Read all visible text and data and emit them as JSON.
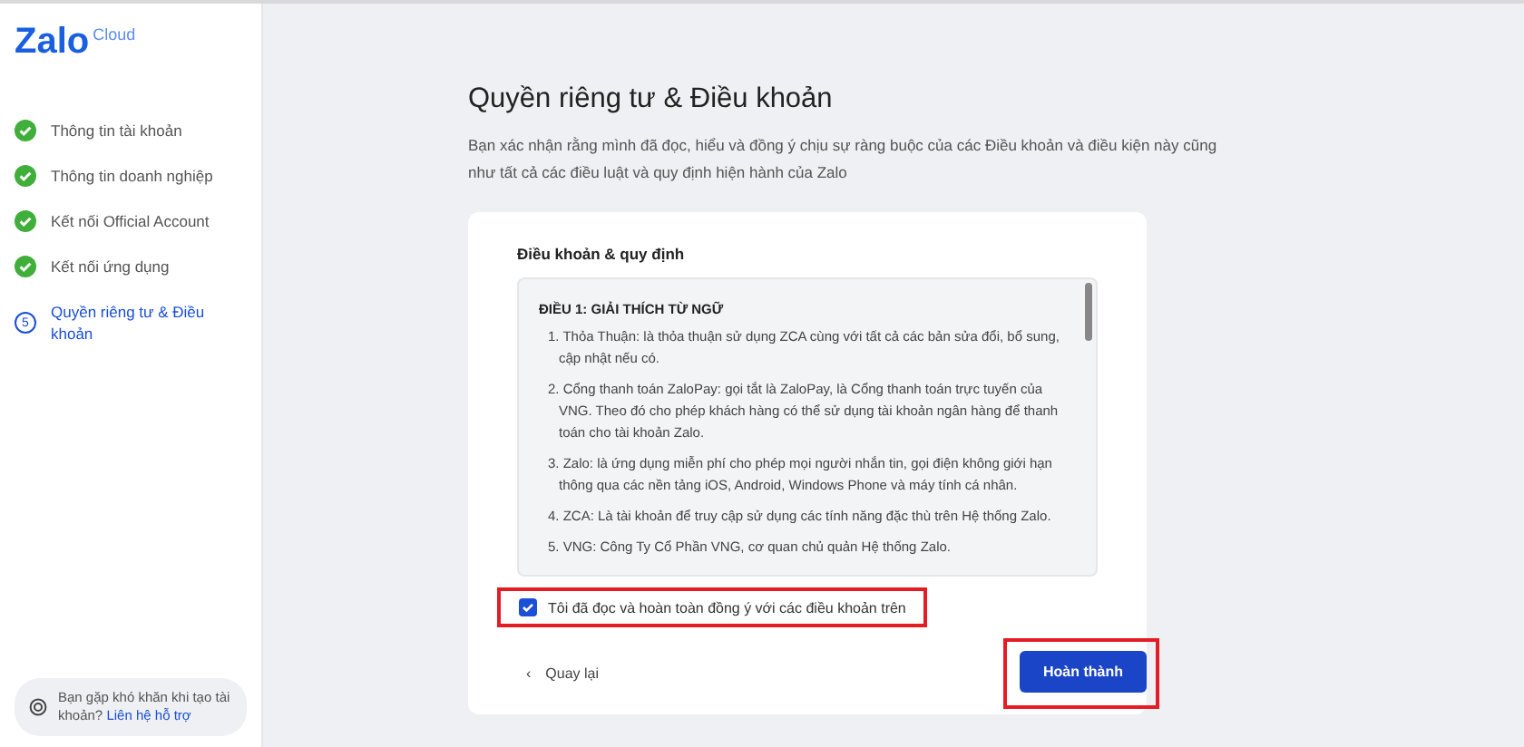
{
  "logo": {
    "text": "Zalo",
    "sub": "Cloud"
  },
  "steps": [
    {
      "kind": "done",
      "label": "Thông tin tài khoản"
    },
    {
      "kind": "done",
      "label": "Thông tin doanh nghiệp"
    },
    {
      "kind": "done",
      "label": "Kết nối Official Account"
    },
    {
      "kind": "done",
      "label": "Kết nối ứng dụng"
    },
    {
      "kind": "current",
      "number": "5",
      "label": "Quyền riêng tư & Điều khoản"
    }
  ],
  "help": {
    "text": "Bạn gặp khó khăn khi tạo tài khoản?",
    "link": "Liên hệ hỗ trợ"
  },
  "title": "Quyền riêng tư & Điều khoản",
  "intro": "Bạn xác nhận rằng mình đã đọc, hiểu và đồng ý chịu sự ràng buộc của các Điều khoản và điều kiện này cũng như tất cả các điều luật và quy định hiện hành của Zalo",
  "card": {
    "heading": "Điều khoản & quy định",
    "terms": {
      "section": "ĐIỀU 1: GIẢI THÍCH TỪ NGỮ",
      "items": [
        "1. Thỏa Thuận: là thỏa thuận sử dụng ZCA cùng với tất cả các bản sửa đổi, bổ sung, cập nhật nếu có.",
        "2. Cổng thanh toán ZaloPay: gọi tắt là ZaloPay, là Cổng thanh toán trực tuyến của VNG. Theo đó cho phép khách hàng có thể sử dụng tài khoản ngân hàng để thanh toán cho tài khoản Zalo.",
        "3. Zalo: là ứng dụng miễn phí cho phép mọi người nhắn tin, gọi điện không giới hạn thông qua các nền tảng iOS, Android, Windows Phone và máy tính cá nhân.",
        "4. ZCA: Là tài khoản để truy cập sử dụng các tính năng đặc thù trên Hệ thống Zalo.",
        "5. VNG: Công Ty Cổ Phần VNG, cơ quan chủ quản Hệ thống Zalo."
      ]
    },
    "agree": {
      "label": "Tôi đã đọc và hoàn toàn đồng ý với các điều khoản trên",
      "checked": true,
      "highlighted": true
    },
    "back": {
      "icon": "‹",
      "label": "Quay lại"
    },
    "submit": {
      "label": "Hoàn thành",
      "highlighted": true
    }
  }
}
